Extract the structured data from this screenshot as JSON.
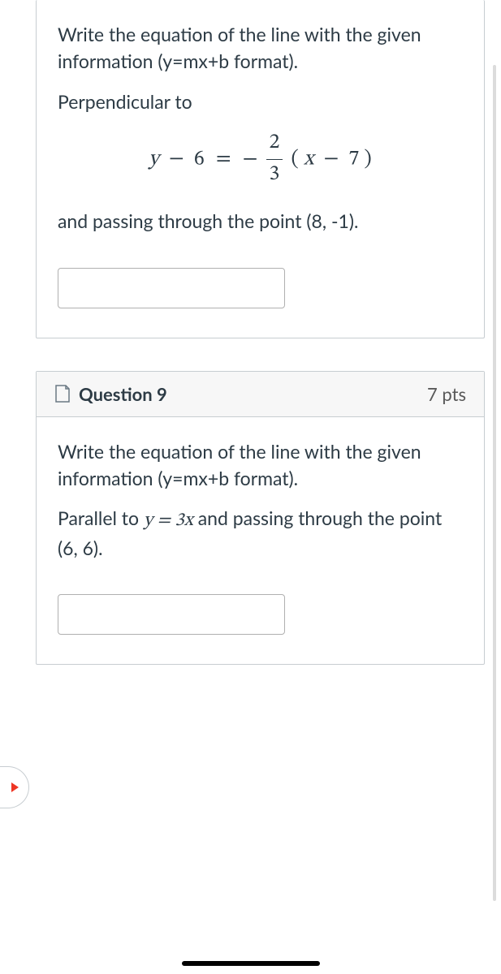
{
  "q8": {
    "prompt1": "Write the equation of the line with the given information (y=mx+b format).",
    "prompt2": "Perpendicular to",
    "eq": {
      "lhs_y": "y",
      "minus1": "−",
      "c1": "6",
      "equals": "=",
      "neg": "−",
      "frac_num": "2",
      "frac_den": "3",
      "lparen": "(",
      "x": "x",
      "minus2": "−",
      "c2": "7",
      "rparen": ")"
    },
    "prompt3": "and passing through the point (8, -1).",
    "answer": ""
  },
  "q9": {
    "header": "Question 9",
    "points": "7 pts",
    "prompt1": "Write the equation of the line with the given information (y=mx+b format).",
    "prompt2_pre": "Parallel to  ",
    "prompt2_eq": "y = 3x",
    "prompt2_post": " and passing through the point (6, 6).",
    "answer": ""
  }
}
